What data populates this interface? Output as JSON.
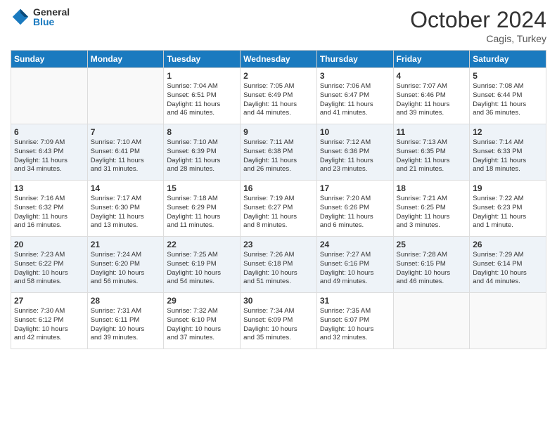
{
  "header": {
    "logo_general": "General",
    "logo_blue": "Blue",
    "title": "October 2024",
    "location": "Cagis, Turkey"
  },
  "weekdays": [
    "Sunday",
    "Monday",
    "Tuesday",
    "Wednesday",
    "Thursday",
    "Friday",
    "Saturday"
  ],
  "weeks": [
    [
      {
        "day": "",
        "info": ""
      },
      {
        "day": "",
        "info": ""
      },
      {
        "day": "1",
        "info": "Sunrise: 7:04 AM\nSunset: 6:51 PM\nDaylight: 11 hours\nand 46 minutes."
      },
      {
        "day": "2",
        "info": "Sunrise: 7:05 AM\nSunset: 6:49 PM\nDaylight: 11 hours\nand 44 minutes."
      },
      {
        "day": "3",
        "info": "Sunrise: 7:06 AM\nSunset: 6:47 PM\nDaylight: 11 hours\nand 41 minutes."
      },
      {
        "day": "4",
        "info": "Sunrise: 7:07 AM\nSunset: 6:46 PM\nDaylight: 11 hours\nand 39 minutes."
      },
      {
        "day": "5",
        "info": "Sunrise: 7:08 AM\nSunset: 6:44 PM\nDaylight: 11 hours\nand 36 minutes."
      }
    ],
    [
      {
        "day": "6",
        "info": "Sunrise: 7:09 AM\nSunset: 6:43 PM\nDaylight: 11 hours\nand 34 minutes."
      },
      {
        "day": "7",
        "info": "Sunrise: 7:10 AM\nSunset: 6:41 PM\nDaylight: 11 hours\nand 31 minutes."
      },
      {
        "day": "8",
        "info": "Sunrise: 7:10 AM\nSunset: 6:39 PM\nDaylight: 11 hours\nand 28 minutes."
      },
      {
        "day": "9",
        "info": "Sunrise: 7:11 AM\nSunset: 6:38 PM\nDaylight: 11 hours\nand 26 minutes."
      },
      {
        "day": "10",
        "info": "Sunrise: 7:12 AM\nSunset: 6:36 PM\nDaylight: 11 hours\nand 23 minutes."
      },
      {
        "day": "11",
        "info": "Sunrise: 7:13 AM\nSunset: 6:35 PM\nDaylight: 11 hours\nand 21 minutes."
      },
      {
        "day": "12",
        "info": "Sunrise: 7:14 AM\nSunset: 6:33 PM\nDaylight: 11 hours\nand 18 minutes."
      }
    ],
    [
      {
        "day": "13",
        "info": "Sunrise: 7:16 AM\nSunset: 6:32 PM\nDaylight: 11 hours\nand 16 minutes."
      },
      {
        "day": "14",
        "info": "Sunrise: 7:17 AM\nSunset: 6:30 PM\nDaylight: 11 hours\nand 13 minutes."
      },
      {
        "day": "15",
        "info": "Sunrise: 7:18 AM\nSunset: 6:29 PM\nDaylight: 11 hours\nand 11 minutes."
      },
      {
        "day": "16",
        "info": "Sunrise: 7:19 AM\nSunset: 6:27 PM\nDaylight: 11 hours\nand 8 minutes."
      },
      {
        "day": "17",
        "info": "Sunrise: 7:20 AM\nSunset: 6:26 PM\nDaylight: 11 hours\nand 6 minutes."
      },
      {
        "day": "18",
        "info": "Sunrise: 7:21 AM\nSunset: 6:25 PM\nDaylight: 11 hours\nand 3 minutes."
      },
      {
        "day": "19",
        "info": "Sunrise: 7:22 AM\nSunset: 6:23 PM\nDaylight: 11 hours\nand 1 minute."
      }
    ],
    [
      {
        "day": "20",
        "info": "Sunrise: 7:23 AM\nSunset: 6:22 PM\nDaylight: 10 hours\nand 58 minutes."
      },
      {
        "day": "21",
        "info": "Sunrise: 7:24 AM\nSunset: 6:20 PM\nDaylight: 10 hours\nand 56 minutes."
      },
      {
        "day": "22",
        "info": "Sunrise: 7:25 AM\nSunset: 6:19 PM\nDaylight: 10 hours\nand 54 minutes."
      },
      {
        "day": "23",
        "info": "Sunrise: 7:26 AM\nSunset: 6:18 PM\nDaylight: 10 hours\nand 51 minutes."
      },
      {
        "day": "24",
        "info": "Sunrise: 7:27 AM\nSunset: 6:16 PM\nDaylight: 10 hours\nand 49 minutes."
      },
      {
        "day": "25",
        "info": "Sunrise: 7:28 AM\nSunset: 6:15 PM\nDaylight: 10 hours\nand 46 minutes."
      },
      {
        "day": "26",
        "info": "Sunrise: 7:29 AM\nSunset: 6:14 PM\nDaylight: 10 hours\nand 44 minutes."
      }
    ],
    [
      {
        "day": "27",
        "info": "Sunrise: 7:30 AM\nSunset: 6:12 PM\nDaylight: 10 hours\nand 42 minutes."
      },
      {
        "day": "28",
        "info": "Sunrise: 7:31 AM\nSunset: 6:11 PM\nDaylight: 10 hours\nand 39 minutes."
      },
      {
        "day": "29",
        "info": "Sunrise: 7:32 AM\nSunset: 6:10 PM\nDaylight: 10 hours\nand 37 minutes."
      },
      {
        "day": "30",
        "info": "Sunrise: 7:34 AM\nSunset: 6:09 PM\nDaylight: 10 hours\nand 35 minutes."
      },
      {
        "day": "31",
        "info": "Sunrise: 7:35 AM\nSunset: 6:07 PM\nDaylight: 10 hours\nand 32 minutes."
      },
      {
        "day": "",
        "info": ""
      },
      {
        "day": "",
        "info": ""
      }
    ]
  ]
}
